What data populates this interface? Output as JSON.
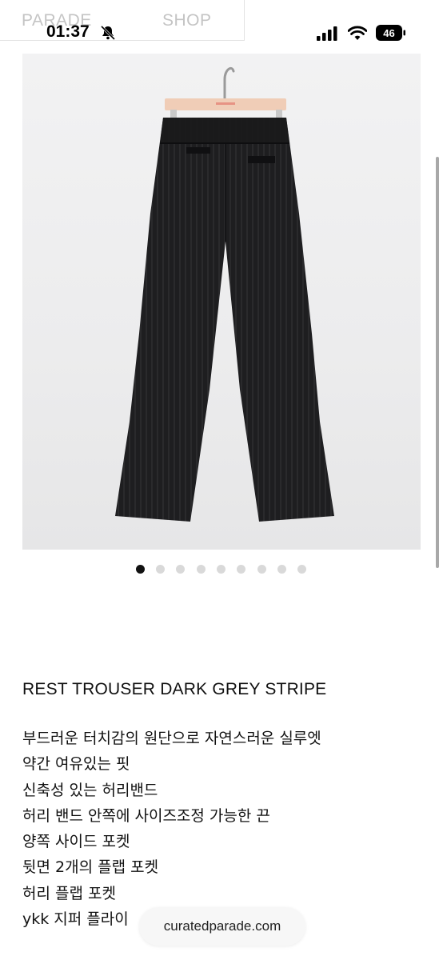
{
  "status_bar": {
    "time": "01:37",
    "battery_level": "46"
  },
  "site_header": {
    "brand": "PARADE",
    "shop": "SHOP"
  },
  "gallery": {
    "total_images": 9,
    "active_index": 0
  },
  "product": {
    "title": "REST TROUSER DARK GREY STRIPE",
    "description_lines": [
      "부드러운 터치감의 원단으로 자연스러운 실루엣",
      "약간 여유있는 핏",
      "신축성 있는 허리밴드",
      "허리 밴드 안쪽에 사이즈조정 가능한 끈",
      "양쪽 사이드 포켓",
      "뒷면 2개의 플랩 포켓",
      "허리 플랩 포켓",
      "ykk 지퍼 플라이"
    ]
  },
  "browser": {
    "url": "curatedparade.com"
  },
  "colors": {
    "pants": "#1e1e20",
    "hanger": "#f0cdb7",
    "hook": "#9a9a9a",
    "active_dot": "#111111",
    "inactive_dot": "#d9d9d9"
  }
}
